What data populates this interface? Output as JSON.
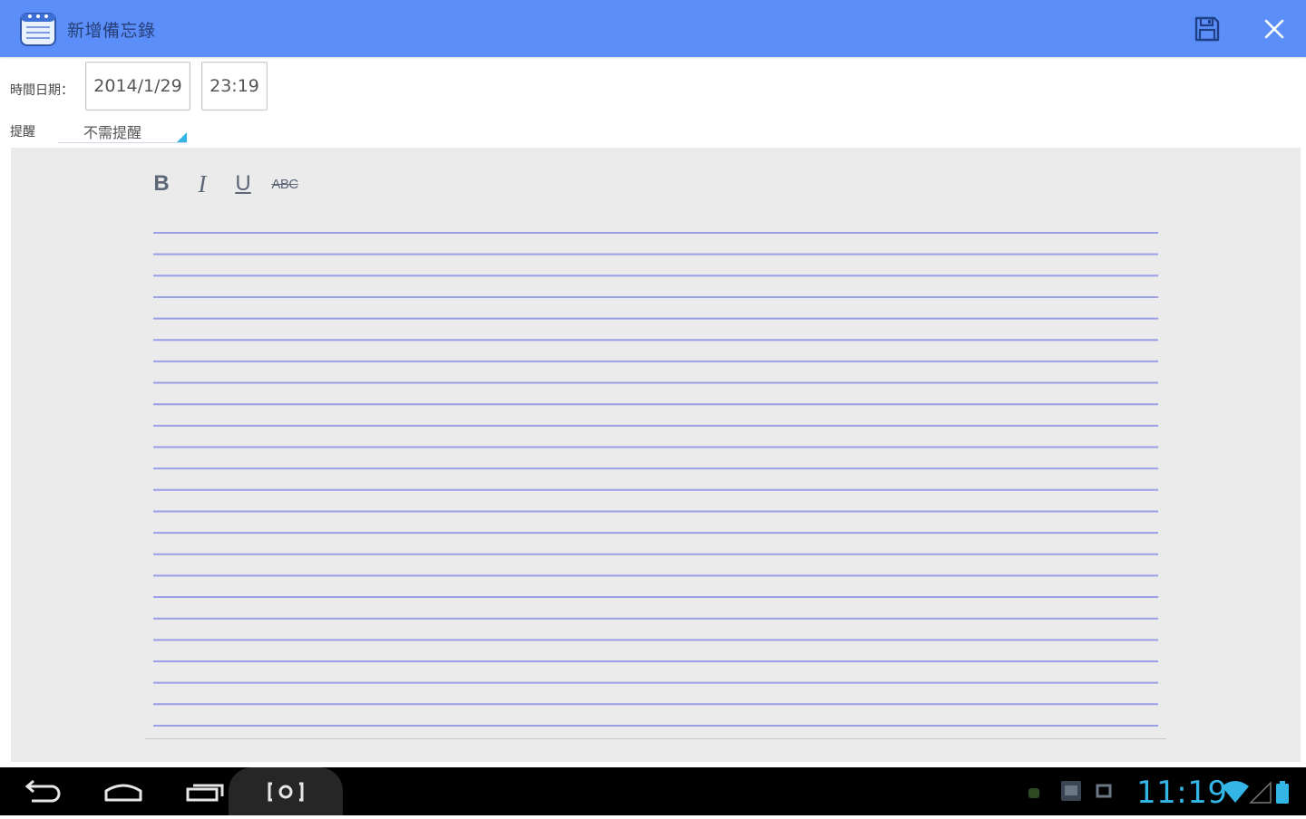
{
  "app": {
    "title": "新增備忘錄",
    "icons": {
      "app": "notepad-icon",
      "save": "save-icon",
      "close": "close-icon"
    },
    "colors": {
      "titlebar": "#5b8ef8",
      "note_line": "#9a9fe6",
      "accent": "#33b5e5"
    }
  },
  "form": {
    "datetime_label": "時間日期：",
    "date_value": "2014/1/29",
    "time_value": "23:19",
    "reminder_label": "提醒",
    "reminder_value": "不需提醒"
  },
  "format_toolbar": {
    "bold": "B",
    "italic": "I",
    "underline": "U",
    "strikethrough": "ABC"
  },
  "editor": {
    "line_count": 24,
    "content": ""
  },
  "system_bar": {
    "time": "11:19",
    "icons": [
      "back-icon",
      "home-icon",
      "recent-apps-icon",
      "screenshot-icon",
      "android-icon",
      "photo-icon",
      "storage-icon",
      "wifi-icon",
      "signal-icon",
      "battery-icon"
    ]
  }
}
